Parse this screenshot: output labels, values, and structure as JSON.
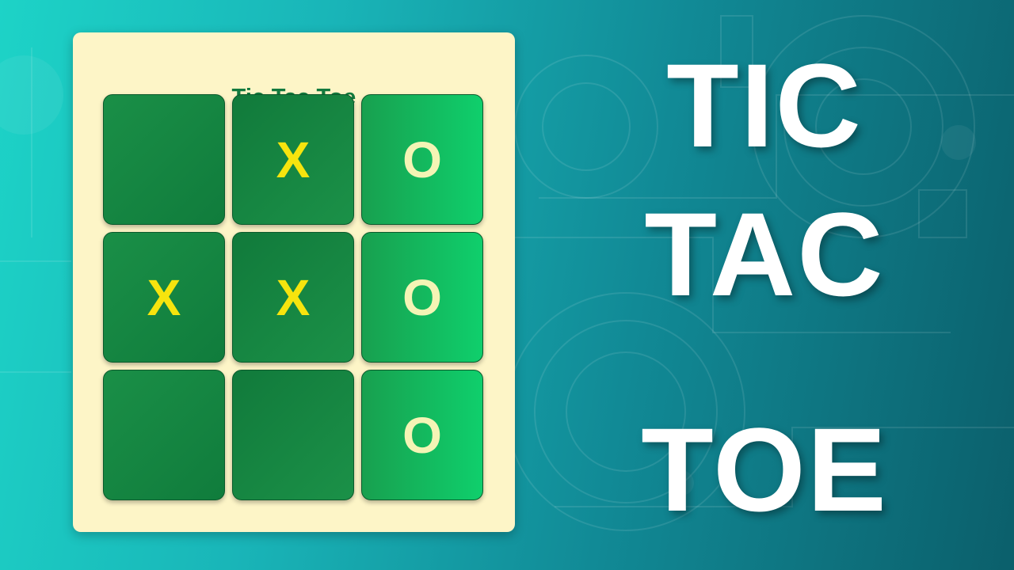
{
  "game": {
    "title": "Tic Tac Toe",
    "board": [
      {
        "value": "",
        "mark": ""
      },
      {
        "value": "X",
        "mark": "x"
      },
      {
        "value": "O",
        "mark": "o"
      },
      {
        "value": "X",
        "mark": "x"
      },
      {
        "value": "X",
        "mark": "x"
      },
      {
        "value": "O",
        "mark": "o"
      },
      {
        "value": "",
        "mark": ""
      },
      {
        "value": "",
        "mark": ""
      },
      {
        "value": "O",
        "mark": "o"
      }
    ]
  },
  "headline": {
    "line1": "TIC",
    "line2": "TAC",
    "line3": "TOE"
  },
  "colors": {
    "card": "#fdf5c7",
    "title": "#137a3e",
    "x_mark": "#f6e40e",
    "o_mark": "#f4f4b5",
    "cell_dark": "#107c3c",
    "cell_light": "#0fcf6c",
    "background_start": "#1dd3c7",
    "background_end": "#0b5f6b"
  }
}
